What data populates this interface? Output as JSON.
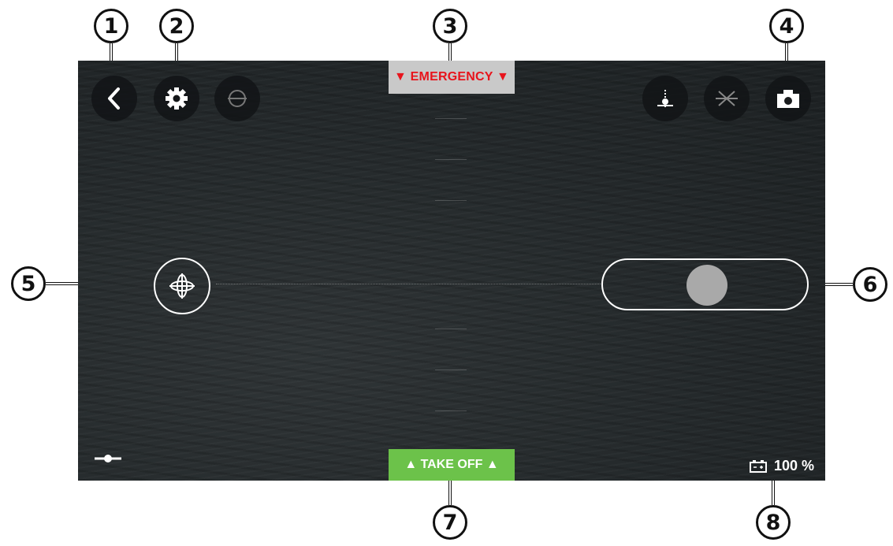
{
  "callouts": [
    "1",
    "2",
    "3",
    "4",
    "5",
    "6",
    "7",
    "8"
  ],
  "top_bar": {
    "back_icon": "chevron-left-icon",
    "settings_icon": "gear-icon",
    "level_icon": "level-indicator-icon",
    "emergency_label": "▼ EMERGENCY ▼",
    "emergency_color": "#e8141c",
    "altitude_icon": "altitude-limit-icon",
    "disabled_icon": "wings-off-icon",
    "camera_icon": "camera-icon"
  },
  "controls": {
    "left_joystick_icon": "rotation-joystick-icon",
    "right_slider_label": "throttle-slider"
  },
  "bottom_bar": {
    "takeoff_label": "▲ TAKE OFF ▲",
    "takeoff_color": "#6cc24a",
    "battery_icon": "battery-icon",
    "battery_text": "100 %",
    "battery_level": 100,
    "trim_icon": "slider-icon"
  }
}
